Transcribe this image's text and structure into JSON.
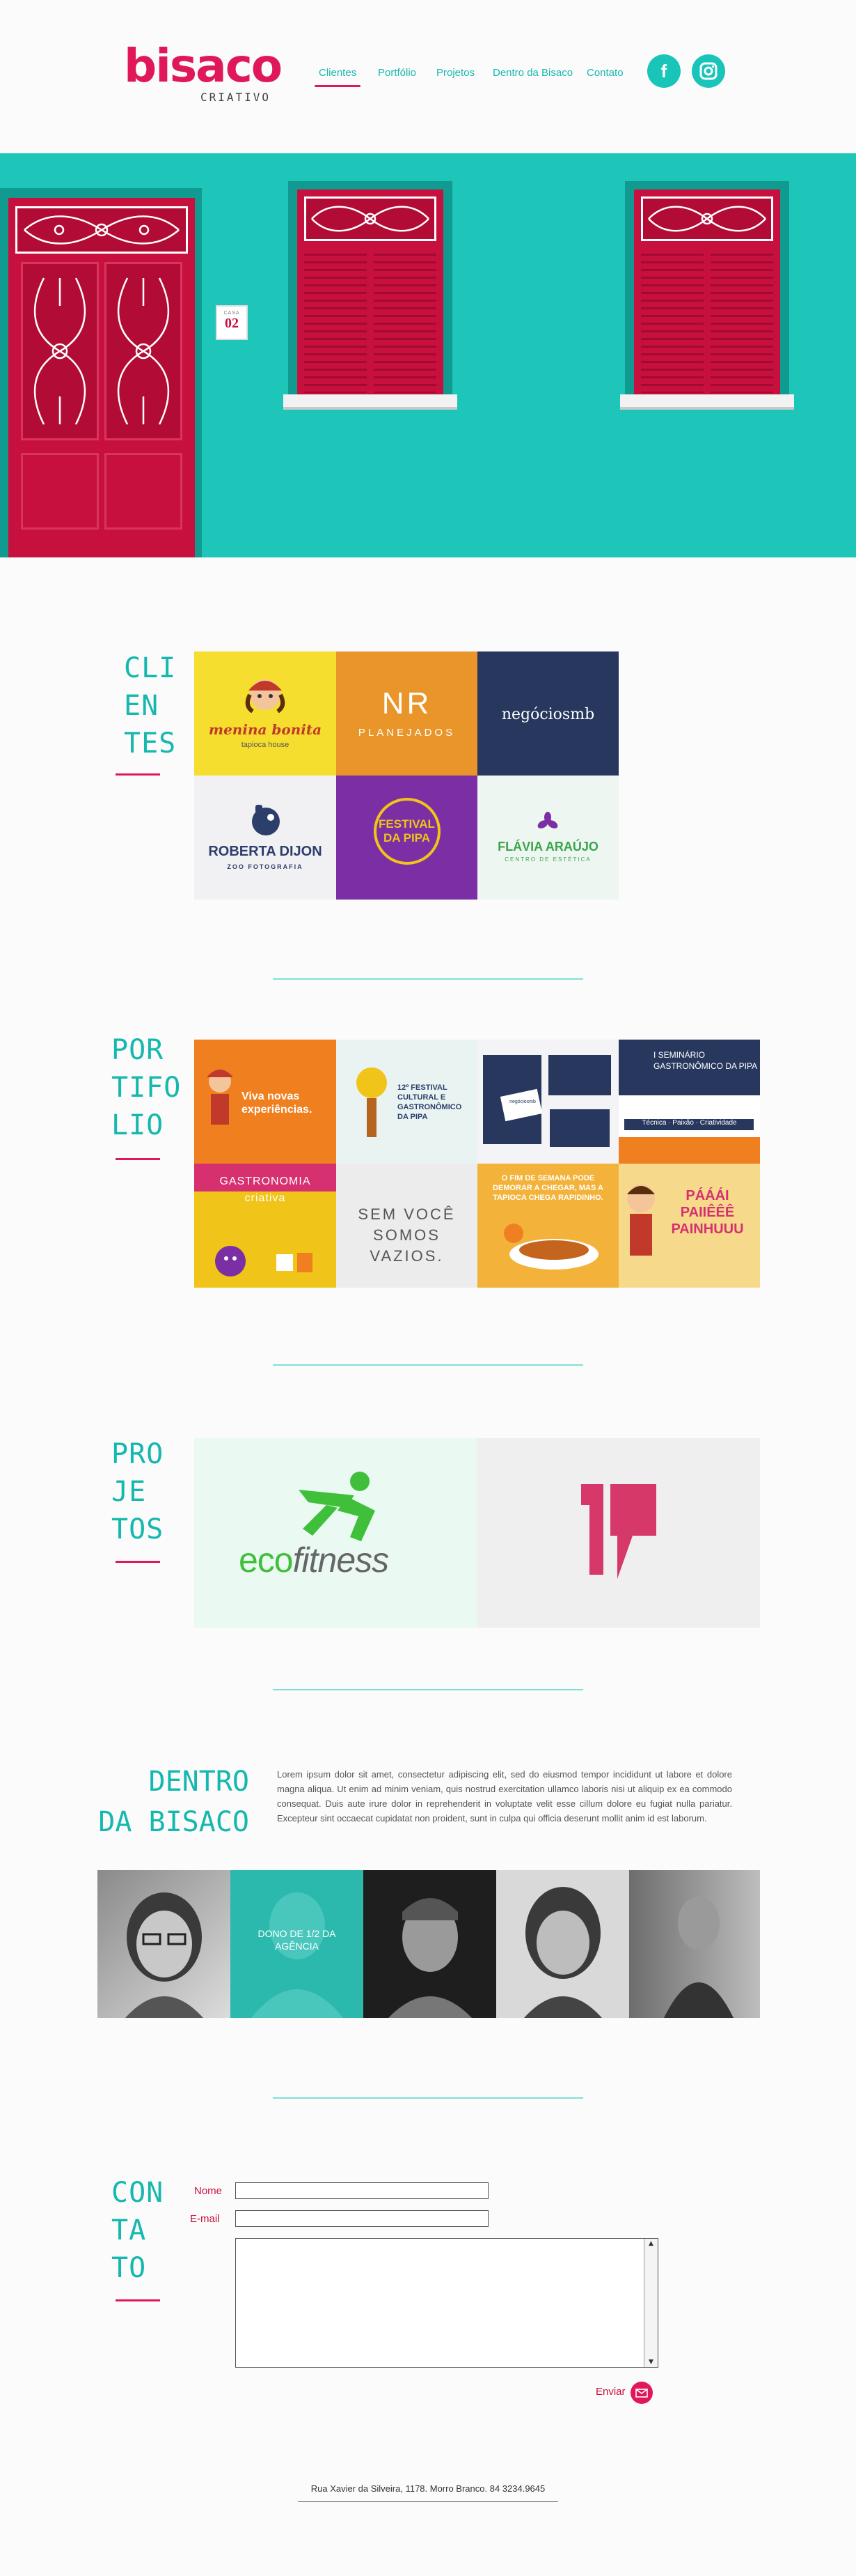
{
  "header": {
    "logo_main": "bisaco",
    "logo_sub": "CRIATIVO",
    "nav": [
      "Clientes",
      "Portfólio",
      "Projetos",
      "Dentro da Bisaco",
      "Contato"
    ],
    "social": [
      {
        "icon": "facebook-icon",
        "glyph": "f"
      },
      {
        "icon": "instagram-icon",
        "glyph": "◎"
      }
    ]
  },
  "hero": {
    "plaque_small": "CASA",
    "plaque_number": "02",
    "colors": {
      "wall": "#1ec5b9",
      "door": "#c8103e"
    }
  },
  "clients": {
    "title_lines": [
      "CLI",
      "EN",
      "TES"
    ],
    "items": [
      {
        "name": "menina bonita",
        "sub": "tapioca house"
      },
      {
        "name": "NR",
        "sub": "PLANEJADOS"
      },
      {
        "name": "negóciosmb",
        "sub": ""
      },
      {
        "name": "ROBERTA DIJON",
        "sub": "ZOO FOTOGRAFIA"
      },
      {
        "name": "FESTIVAL DA PIPA",
        "sub": ""
      },
      {
        "name": "FLÁVIA ARAÚJO",
        "sub": "CENTRO DE ESTÉTICA"
      }
    ]
  },
  "portfolio": {
    "title_lines": [
      "POR",
      "TIFO",
      "LIO"
    ],
    "items": [
      {
        "text": "Viva novas experiências."
      },
      {
        "text": "12º FESTIVAL CULTURAL E GASTRONÔMICO DA PIPA"
      },
      {
        "text": "negóciosmb"
      },
      {
        "text": "I SEMINÁRIO GASTRONÔMICO DA PIPA"
      },
      {
        "text": "Técnica · Paixão · Criatividade"
      },
      {
        "text": "GASTRONOMIA criativa"
      },
      {
        "text": "SEM VOCÊ SOMOS VAZIOS."
      },
      {
        "text": "O FIM DE SEMANA PODE DEMORAR A CHEGAR, MAS A TAPIOCA CHEGA RAPIDINHO."
      },
      {
        "text": "PÁÁÁI PAIIÊÊÊ PAINHUUU"
      }
    ]
  },
  "projects": {
    "title_lines": [
      "PRO",
      "JE",
      "TOS"
    ],
    "items": [
      {
        "name": "ecofitness",
        "prefix": "eco",
        "suffix": "fitness"
      },
      {
        "name": "1 vírgula",
        "glyph": "1"
      }
    ]
  },
  "about": {
    "title_lines": [
      "DENTRO",
      "DA BISACO"
    ],
    "text": "Lorem ipsum dolor sit amet, consectetur adipiscing elit, sed do eiusmod tempor incididunt ut labore et dolore magna aliqua. Ut enim ad minim veniam, quis nostrud exercitation ullamco laboris nisi ut aliquip ex ea commodo consequat. Duis aute irure dolor in reprehenderit in voluptate velit esse cillum dolore eu fugiat nulla pariatur. Excepteur sint occaecat cupidatat non proident, sunt in culpa qui officia deserunt mollit anim id est laborum.",
    "photo_caption": "DONO DE 1/2 DA AGÊNCIA"
  },
  "contact": {
    "title_lines": [
      "CON",
      "TA",
      "TO"
    ],
    "name_label": "Nome",
    "email_label": "E-mail",
    "name_value": "",
    "email_value": "",
    "message_value": "",
    "send_label": "Enviar"
  },
  "footer": {
    "address": "Rua Xavier da Silveira, 1178. Morro Branco. 84 3234.9645"
  }
}
